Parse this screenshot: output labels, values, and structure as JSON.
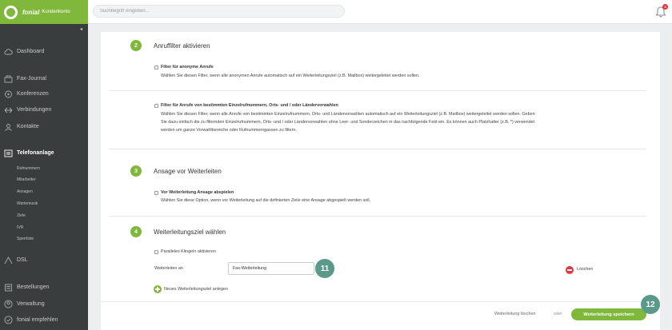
{
  "header": {
    "brand": "fonial",
    "brand_suffix": "Kundenkonto",
    "search_placeholder": "Suchbegriff eingeben...",
    "notification_count": "3"
  },
  "sidebar": {
    "collapse_glyph": "◂",
    "items": [
      {
        "label": "Dashboard",
        "icon": "cloud-icon"
      },
      {
        "label": "Fax-Journal",
        "icon": "fax-icon"
      },
      {
        "label": "Konferenzen",
        "icon": "conference-icon"
      },
      {
        "label": "Verbindungen",
        "icon": "connections-icon"
      },
      {
        "label": "Kontakte",
        "icon": "contacts-icon"
      },
      {
        "label": "Telefonanlage",
        "icon": "phone-system-icon",
        "active": true
      },
      {
        "label": "DSL",
        "icon": "dsl-icon"
      },
      {
        "label": "Bestellungen",
        "icon": "orders-icon"
      },
      {
        "label": "Verwaltung",
        "icon": "user-icon"
      },
      {
        "label": "fonial empfehlen",
        "icon": "recommend-icon"
      }
    ],
    "subitems": [
      "Rufnummern",
      "Mitarbeiter",
      "Ansagen",
      "Wartemusik",
      "Ziele",
      "IVR",
      "Sperrliste"
    ]
  },
  "main": {
    "section2": {
      "num": "2",
      "title": "Anruffilter aktivieren",
      "opt1_title": "Filter für anonyme Anrufe",
      "opt1_desc": "Wählen Sie diesen Filter, wenn alle anonymen Anrufe automatisch auf ein Weiterleitungsziel (z.B. Mailbox) weitergeleitet werden sollen.",
      "opt2_title": "Filter für Anrufe von bestimmten Einzelrufnummern, Orts- und / oder Länder­vorwahlen",
      "opt2_desc_l1": "Wählen Sie diesen Filter, wenn alle Anrufe von bestimmten Einzelrufnummern, Orts- und Ländervorwahlen automatisch auf ein Weiterleitungsziel (z.B. Mailbox) weitergeleitet werden sollen. Geben",
      "opt2_desc_l2": "Sie dazu einfach die zu filternden Einzelrufnummern, Orts- und / oder Ländervorwahlen ohne Leer- und Sonderzeichen in das nachfolgende Feld ein. Es können auch Platzhalter (z.B. *) verwendet",
      "opt2_desc_l3": "werden um ganze Vorwahlbereiche oder Rufnummerngassen zu filtern."
    },
    "section3": {
      "num": "3",
      "title": "Ansage vor Weiterleiten",
      "opt_title": "Vor Weiterleitung Ansage abspielen",
      "opt_desc": "Wählen Sie diese Option, wenn vor Weiterleitung auf die definierten Ziele eine Ansage abgespielt werden soll."
    },
    "section4": {
      "num": "4",
      "title": "Weiterleitungsziel wählen",
      "parallel_label": "Paralleles Klingeln aktivieren",
      "forward_label": "Weiterleiten an",
      "forward_value": "Fax-Weiterleitung",
      "delete_label": "Löschen",
      "add_label": "Neues Weiterleitungsziel anlegen"
    },
    "callouts": {
      "first": "11",
      "second": "12"
    },
    "footer": {
      "delete_link": "Weiterleitung löschen",
      "or": "oder",
      "save": "Weiterleitung speichern"
    }
  },
  "colors": {
    "accent": "#7fb83a",
    "sidebar": "#3a3d3e",
    "danger": "#e0383e",
    "callout": "#5b9a8b"
  }
}
